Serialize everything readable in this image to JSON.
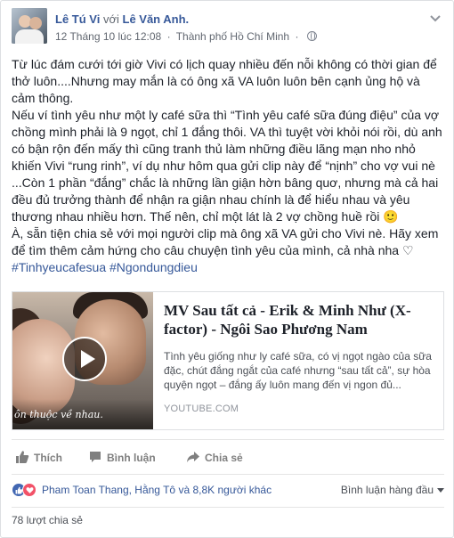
{
  "post": {
    "author": "Lê Tú Vi",
    "with_word": "với",
    "tagged": "Lê Văn Anh.",
    "timestamp": "12 Tháng 10 lúc 12:08",
    "separator": "·",
    "location": "Thành phố Hồ Chí Minh",
    "privacy_icon": "globe-icon",
    "paragraph1": "Từ lúc đám cưới tới giờ Vivi có lịch quay nhiều đến nỗi không có thời gian để thở luôn....Nhưng may mắn là có ông xã VA luôn luôn bên cạnh ủng hộ và cảm thông.",
    "paragraph2": "Nếu ví tình yêu như một ly café sữa thì “Tình yêu café sữa đúng điệu” của vợ chồng mình phải là 9 ngọt, chỉ 1 đắng thôi. VA thì tuyệt vời khỏi nói rồi, dù anh có bận rộn đến mấy thì cũng tranh thủ làm những điều lãng mạn nho nhỏ khiến Vivi “rung rinh”, ví dụ như hôm qua gửi clip này để “nịnh” cho vợ vui nè ...Còn 1 phần “đắng” chắc là những lần giận hờn bâng quơ, nhưng mà cả hai đều đủ trưởng thành để nhận ra giận nhau chính là để hiểu nhau và yêu thương nhau nhiều hơn. Thế nên, chỉ một lát là 2 vợ chồng huề rồi 🙂",
    "paragraph3": "À, sẵn tiện chia sẻ với mọi người clip mà ông xã VA gửi cho Vivi nè. Hãy xem để tìm thêm cảm hứng cho câu chuyện tình yêu của mình, cả nhà nha ♡",
    "hashtags": "#Tinhyeucafesua #Ngondungdieu"
  },
  "link": {
    "title": "MV Sau tất cả - Erik & Minh Như (X-factor) - Ngôi Sao Phương Nam",
    "description": "Tình yêu giống như ly café sữa, có vị ngọt ngào của sữa đặc, chút đắng ngắt của café nhưng “sau tất cả”, sự hòa quyện ngọt – đắng ấy luôn mang đến vị ngon đủ...",
    "domain": "YOUTUBE.COM",
    "thumb_caption": "ôn thuộc về nhau.",
    "play_icon": "play-icon"
  },
  "actions": {
    "like": "Thích",
    "comment": "Bình luận",
    "share": "Chia sẻ"
  },
  "reactions": {
    "text": "Pham Toan Thang, Hằng Tô và 8,8K người khác",
    "sort_label": "Bình luận hàng đầu",
    "like_color": "#4267b2",
    "love_color": "#f25268"
  },
  "shares": {
    "text": "78 lượt chia sẻ"
  },
  "colors": {
    "link_blue": "#365899",
    "text": "#1d2129",
    "muted": "#616770"
  }
}
